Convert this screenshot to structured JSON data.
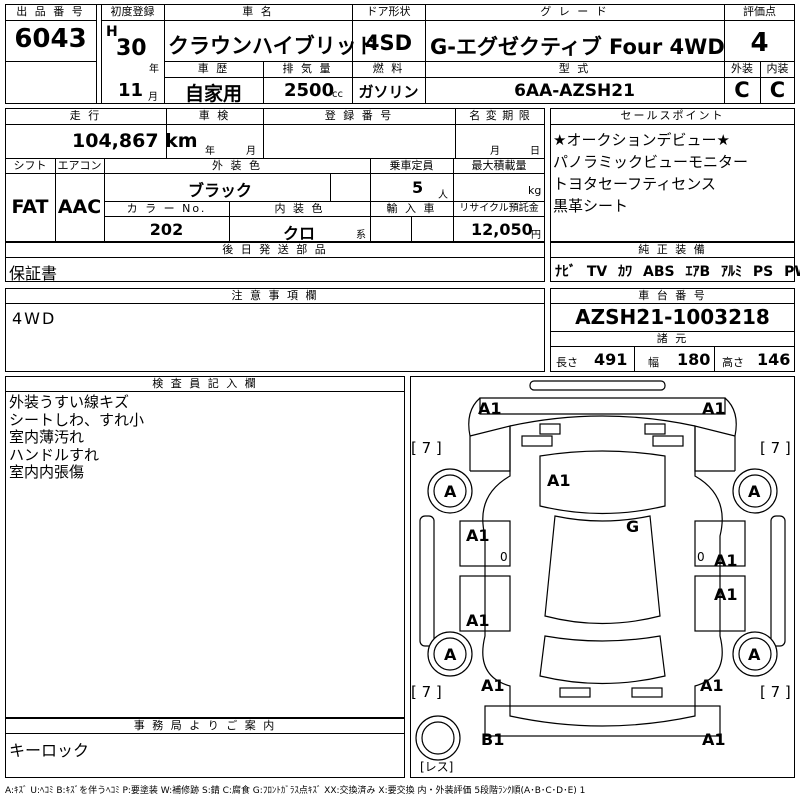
{
  "header": {
    "lot_label": "出 品 番 号",
    "lot_number": "6043",
    "first_reg_label": "初度登録",
    "era": "H",
    "year": "30",
    "year_unit": "年",
    "month": "11",
    "month_unit": "月",
    "model_label": "車 名",
    "model": "クラウンハイブリッド",
    "door_label": "ドア形状",
    "door": "4SD",
    "grade_label": "グ レ ー ド",
    "grade": "G-エグゼクティブ  Four  4WD",
    "score_label": "評価点",
    "score": "4",
    "history_label": "車 歴",
    "history": "自家用",
    "displacement_label": "排 気 量",
    "displacement": "2500",
    "displacement_unit": "cc",
    "fuel_label": "燃 料",
    "fuel": "ガソリン",
    "type_label": "型 式",
    "type": "6AA-AZSH21",
    "exterior_label": "外装",
    "exterior_grade": "C",
    "interior_label": "内装",
    "interior_grade": "C"
  },
  "specs": {
    "mileage_label": "走 行",
    "mileage": "104,867 km",
    "inspection_label": "車 検",
    "inspection_year_unit": "年",
    "inspection_month_unit": "月",
    "registration_label": "登 録 番 号",
    "name_change_label": "名 変 期 限",
    "name_change_month_unit": "月",
    "name_change_day_unit": "日",
    "shift_label": "シフト",
    "shift": "FAT",
    "ac_label": "エアコン",
    "ac": "AAC",
    "color_label": "外 装 色",
    "color": "ブラック",
    "capacity_label": "乗車定員",
    "capacity": "5",
    "capacity_unit": "人",
    "load_label": "最大積載量",
    "load_unit": "kg",
    "color_no_label": "カ ラ ー No.",
    "color_no": "202",
    "interior_color_label": "内 装 色",
    "interior_color": "クロ",
    "interior_color_unit": "系",
    "import_label": "輸 入 車",
    "recycle_label": "リサイクル預託金",
    "recycle": "12,050",
    "recycle_unit": "円"
  },
  "sales_points": {
    "label": "セールスポイント",
    "items": [
      "★オークションデビュー★",
      "パノラミックビューモニター",
      "トヨタセーフティセンス",
      "黒革シート"
    ]
  },
  "equipment": {
    "label": "純 正 装 備",
    "items": [
      "ﾅﾋﾞ",
      "TV",
      "ｶﾜ",
      "ABS",
      "ｴｱB",
      "ｱﾙﾐ",
      "PS",
      "PW"
    ]
  },
  "accessories": {
    "label": "後 日 発 送 部 品",
    "value": "保証書"
  },
  "cautions": {
    "label": "注 意 事 項 欄",
    "value": "4WD"
  },
  "chassis": {
    "label": "車 台 番 号",
    "value": "AZSH21-1003218"
  },
  "dimensions": {
    "label": "諸 元",
    "length_label": "長さ",
    "length": "491",
    "width_label": "幅",
    "width": "180",
    "height_label": "高さ",
    "height": "146"
  },
  "inspector": {
    "label": "検 査 員 記 入 欄",
    "notes": [
      "外装うすい線キズ",
      "シートしわ、すれ小",
      "室内薄汚れ",
      "ハンドルすれ",
      "室内内張傷"
    ]
  },
  "office": {
    "label": "事 務 局 よ り ご 案 内",
    "value": "キーロック"
  },
  "diagram": {
    "marks": {
      "front_left": "A1",
      "front_right": "A1",
      "tire_fl": "A",
      "tire_fr": "A",
      "tire_rl": "A",
      "tire_rr": "A",
      "hood": "A1",
      "glass": "G",
      "door_fl": "A1",
      "door_rl": "A1",
      "door_fr": "A1",
      "door_rr": "A1",
      "rear_left": "A1",
      "rear_right": "A1",
      "bottom_left": "B1",
      "bottom_right": "A1"
    },
    "tread_fl": "[ 7 ]",
    "tread_fr": "[ 7 ]",
    "tread_rl": "[ 7 ]",
    "tread_rr": "[ 7 ]",
    "spare_label": "[レス]",
    "door_zero": "0"
  },
  "legend": "A:ｷｽﾞ U:ﾍｺﾐ B:ｷｽﾞを伴うﾍｺﾐ P:要塗装 W:補修跡 S:錆 C:腐食 G:ﾌﾛﾝﾄｶﾞﾗｽ点ｷｽﾞ XX:交換済み X:要交換  内・外装評価 5段階ﾗﾝｸ順(A･B･C･D･E) 1"
}
